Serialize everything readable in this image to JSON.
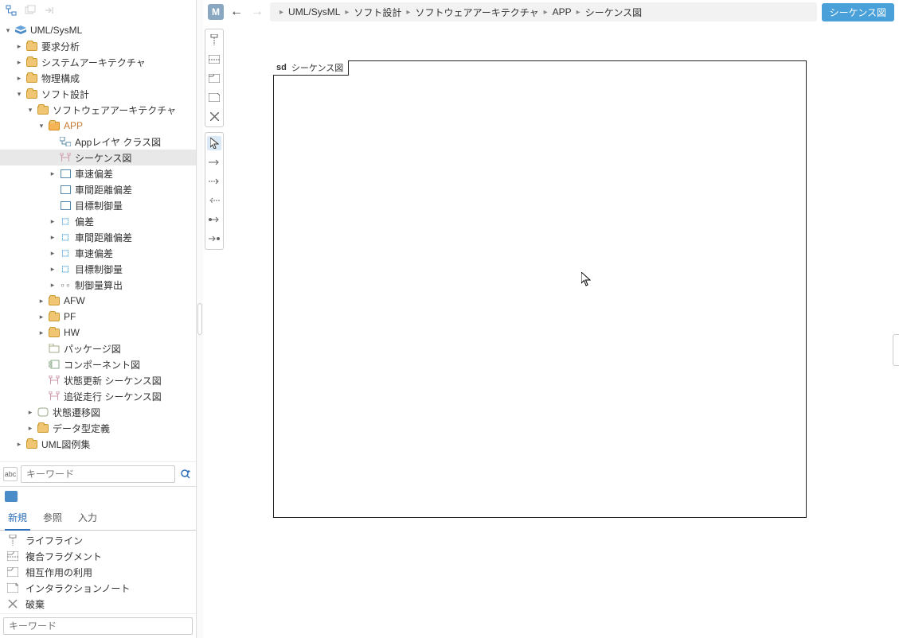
{
  "toolbar": {
    "m_badge": "M"
  },
  "breadcrumb": [
    "UML/SysML",
    "ソフト設計",
    "ソフトウェアアーキテクチャ",
    "APP",
    "シーケンス図"
  ],
  "tag": "シーケンス図",
  "tree": {
    "root": "UML/SysML",
    "items": {
      "req": "要求分析",
      "sysarch": "システムアーキテクチャ",
      "phys": "物理構成",
      "soft": "ソフト設計",
      "swarch": "ソフトウェアアーキテクチャ",
      "app": "APP",
      "appclass": "Appレイヤ クラス図",
      "seq": "シーケンス図",
      "vspeed": "車速偏差",
      "vdist": "車間距離偏差",
      "tctrl": "目標制御量",
      "dev": "偏差",
      "vdist2": "車間距離偏差",
      "vspeed2": "車速偏差",
      "tctrl2": "目標制御量",
      "ctrlcalc": "制御量算出",
      "afw": "AFW",
      "pf": "PF",
      "hw": "HW",
      "pkgdiag": "パッケージ図",
      "compdiag": "コンポーネント図",
      "stateupd": "状態更新 シーケンス図",
      "follow": "追従走行 シーケンス図",
      "statetr": "状態遷移図",
      "datatypes": "データ型定義",
      "examples": "UML図例集"
    }
  },
  "search": {
    "placeholder": "キーワード"
  },
  "tabs": {
    "new": "新規",
    "ref": "参照",
    "input": "入力"
  },
  "palette": {
    "lifeline": "ライフライン",
    "combined": "複合フラグメント",
    "interaction": "相互作用の利用",
    "note": "インタラクションノート",
    "destroy": "破棄"
  },
  "bottom_search": {
    "placeholder": "キーワード"
  },
  "diagram": {
    "prefix": "sd",
    "title": "シーケンス図"
  }
}
